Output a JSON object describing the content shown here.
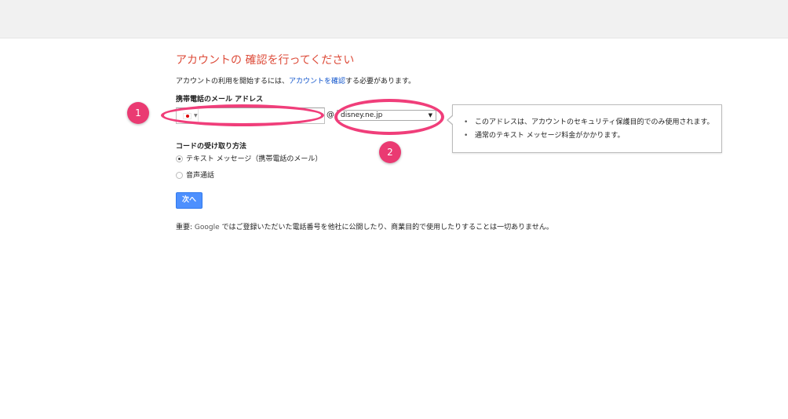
{
  "page": {
    "title": "アカウントの 確認を行ってください",
    "intro_prefix": "アカウントの利用を開始するには、",
    "intro_link": "アカウントを確認",
    "intro_suffix": "する必要があります。"
  },
  "email_form": {
    "label": "携帯電話のメール アドレス",
    "local_part_value": "",
    "at_symbol": "@",
    "domain_selected": "disney.ne.jp",
    "domain_arrow": "▼",
    "flag_caret": "▼"
  },
  "tooltip": {
    "items": [
      "このアドレスは、アカウントのセキュリティ保護目的でのみ使用されます。",
      "通常のテキスト メッセージ料金がかかります。"
    ]
  },
  "code_receipt": {
    "label": "コードの受け取り方法",
    "options": [
      {
        "label": "テキスト メッセージ（携帯電話のメール）",
        "checked": true
      },
      {
        "label": "音声通話",
        "checked": false
      }
    ]
  },
  "next_button": {
    "label": "次へ"
  },
  "notice": {
    "prefix": "重要: ",
    "brand": "Google",
    "text": " ではご登録いただいた電話番号を他社に公開したり、商業目的で使用したりすることは一切ありません。"
  },
  "annotations": {
    "badge_1": "1",
    "badge_2": "2",
    "highlight_color": "#f03e7a"
  },
  "colors": {
    "title_red": "#dd4b39",
    "link_blue": "#1155cc",
    "button_blue": "#4d90fe"
  }
}
